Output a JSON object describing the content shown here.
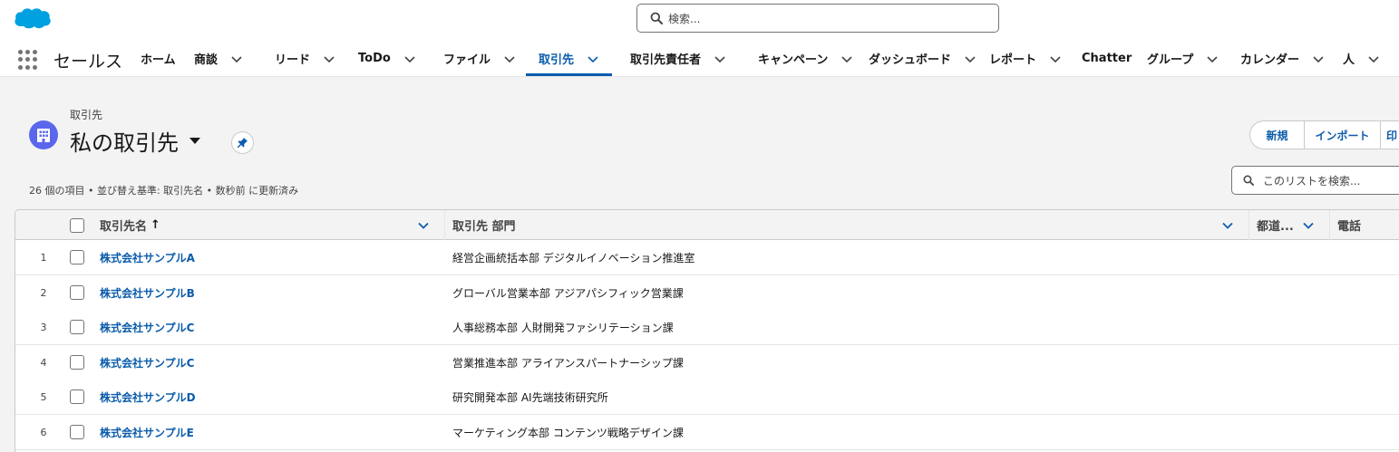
{
  "colors": {
    "brand": "#0b5cab",
    "object_icon": "#5a67ed",
    "salesforce_cloud": "#00a1e0"
  },
  "header": {
    "logo_icon": "salesforce-cloud-icon",
    "search_placeholder": "検索..."
  },
  "app": {
    "name": "セールス",
    "nav": [
      {
        "label": "ホーム",
        "dropdown": false
      },
      {
        "label": "商談",
        "dropdown": true
      },
      {
        "label": "リード",
        "dropdown": true
      },
      {
        "label": "ToDo",
        "dropdown": true
      },
      {
        "label": "ファイル",
        "dropdown": true
      },
      {
        "label": "取引先",
        "dropdown": true,
        "active": true
      },
      {
        "label": "取引先責任者",
        "dropdown": true
      },
      {
        "label": "キャンペーン",
        "dropdown": true
      },
      {
        "label": "ダッシュボード",
        "dropdown": true
      },
      {
        "label": "レポート",
        "dropdown": true
      },
      {
        "label": "Chatter",
        "dropdown": false
      },
      {
        "label": "グループ",
        "dropdown": true
      },
      {
        "label": "カレンダー",
        "dropdown": true
      },
      {
        "label": "人",
        "dropdown": true
      }
    ]
  },
  "page": {
    "object_label": "取引先",
    "view_title": "私の取引先",
    "buttons": {
      "new": "新規",
      "import": "インポート",
      "partial": "印"
    },
    "summary": "26 個の項目 • 並び替え基準: 取引先名 • 数秒前 に更新済み",
    "list_search_placeholder": "このリストを検索..."
  },
  "table": {
    "columns": {
      "name": "取引先名",
      "name_sort": "↑",
      "dept": "取引先 部門",
      "pref": "都道...",
      "phone": "電話"
    },
    "rows": [
      {
        "num": "1",
        "name": "株式会社サンプルA",
        "dept": "経営企画統括本部 デジタルイノベーション推進室"
      },
      {
        "num": "2",
        "name": "株式会社サンプルB",
        "dept": "グローバル営業本部 アジアパシフィック営業課"
      },
      {
        "num": "3",
        "name": "株式会社サンプルC",
        "dept": "人事総務本部 人財開発ファシリテーション課"
      },
      {
        "num": "4",
        "name": "株式会社サンプルC",
        "dept": "営業推進本部 アライアンスパートナーシップ課"
      },
      {
        "num": "5",
        "name": "株式会社サンプルD",
        "dept": "研究開発本部 AI先端技術研究所"
      },
      {
        "num": "6",
        "name": "株式会社サンプルE",
        "dept": "マーケティング本部 コンテンツ戦略デザイン課"
      }
    ]
  }
}
